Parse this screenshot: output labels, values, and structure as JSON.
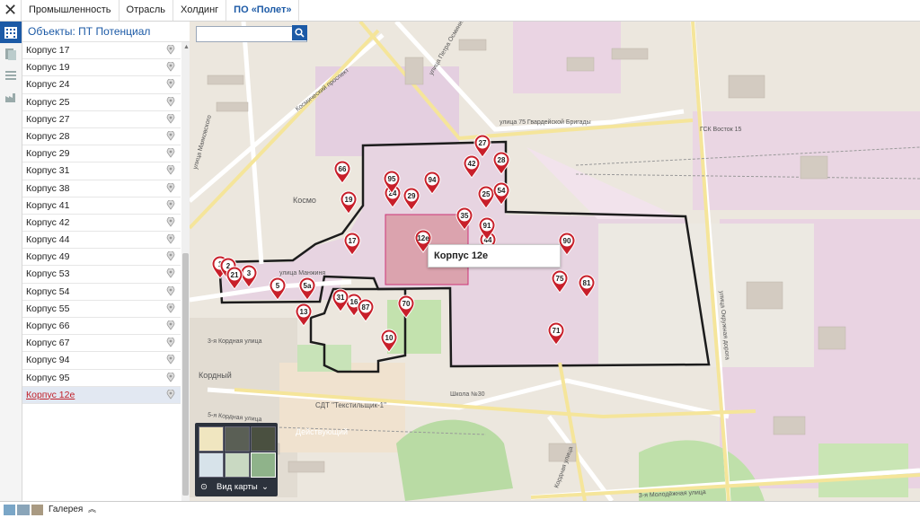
{
  "topbar": {
    "close_icon": "close-icon",
    "crumbs": [
      "Промышленность",
      "Отрасль",
      "Холдинг",
      "ПО «Полет»"
    ]
  },
  "panel": {
    "title": "Объекты: ПТ Потенциал",
    "items": [
      "Корпус 17",
      "Корпус 19",
      "Корпус 24",
      "Корпус 25",
      "Корпус 27",
      "Корпус 28",
      "Корпус 29",
      "Корпус 31",
      "Корпус 38",
      "Корпус 41",
      "Корпус 42",
      "Корпус 44",
      "Корпус 49",
      "Корпус 53",
      "Корпус 54",
      "Корпус 55",
      "Корпус 66",
      "Корпус 67",
      "Корпус 94",
      "Корпус 95",
      "Корпус 12е"
    ],
    "selected": "Корпус 12е"
  },
  "map": {
    "search_placeholder": "",
    "tooltip": "Корпус 12е",
    "layer_switch_label": "Вид карты",
    "markers": [
      "1",
      "2",
      "3",
      "5",
      "5а",
      "10",
      "12е",
      "13",
      "16",
      "17",
      "19",
      "21",
      "24",
      "25",
      "27",
      "28",
      "29",
      "31",
      "35",
      "42",
      "44",
      "54",
      "66",
      "70",
      "71",
      "75",
      "81",
      "87",
      "90",
      "91",
      "94",
      "95"
    ],
    "streets": [
      "Космический проспект",
      "улица 75 Гвардейской Бригады",
      "улица Петра Осминина",
      "улица Маяковского",
      "улица Манжиня",
      "3-я Кордная улица",
      "5-я Кордная улица",
      "улица Окружная дорога",
      "3-я Молодёжная улица",
      "Кордный",
      "СДТ \"Текстильщик-1\"",
      "ГСК Восток 15",
      "Космо",
      "Кордная улица",
      "Школа №30",
      "Действующий"
    ]
  },
  "footer": {
    "gallery_label": "Галерея"
  },
  "colors": {
    "accent": "#1c5aa6",
    "marker": "#c81f2a",
    "selected": "#c0202a",
    "industrial": "#e7d4e1"
  }
}
